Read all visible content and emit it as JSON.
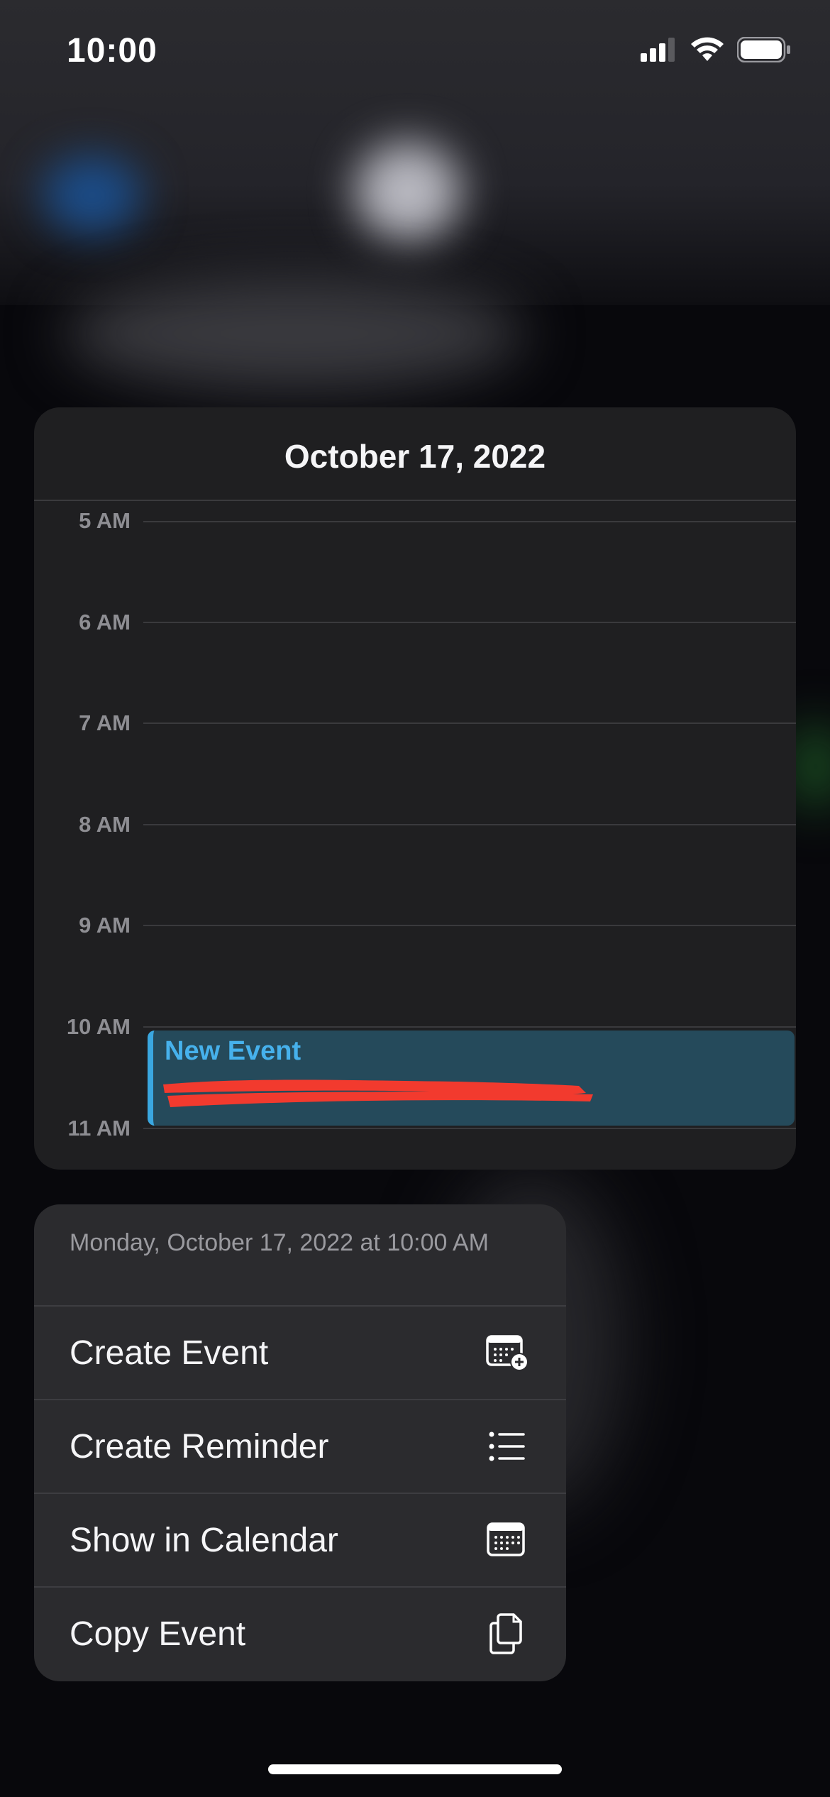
{
  "status_bar": {
    "time": "10:00",
    "icons": [
      "cellular-signal-icon",
      "wifi-icon",
      "battery-icon"
    ]
  },
  "day_view": {
    "date_title": "October 17, 2022",
    "hours": [
      "5 AM",
      "6 AM",
      "7 AM",
      "8 AM",
      "9 AM",
      "10 AM",
      "11 AM"
    ],
    "event": {
      "title": "New Event",
      "accent_color": "#46b1ec",
      "background_color": "#254a5b"
    }
  },
  "context_menu": {
    "header": "Monday, October 17, 2022 at 10:00 AM",
    "items": [
      {
        "label": "Create Event",
        "icon": "calendar-add-icon"
      },
      {
        "label": "Create Reminder",
        "icon": "list-icon"
      },
      {
        "label": "Show in Calendar",
        "icon": "calendar-icon"
      },
      {
        "label": "Copy Event",
        "icon": "copy-icon"
      }
    ]
  }
}
